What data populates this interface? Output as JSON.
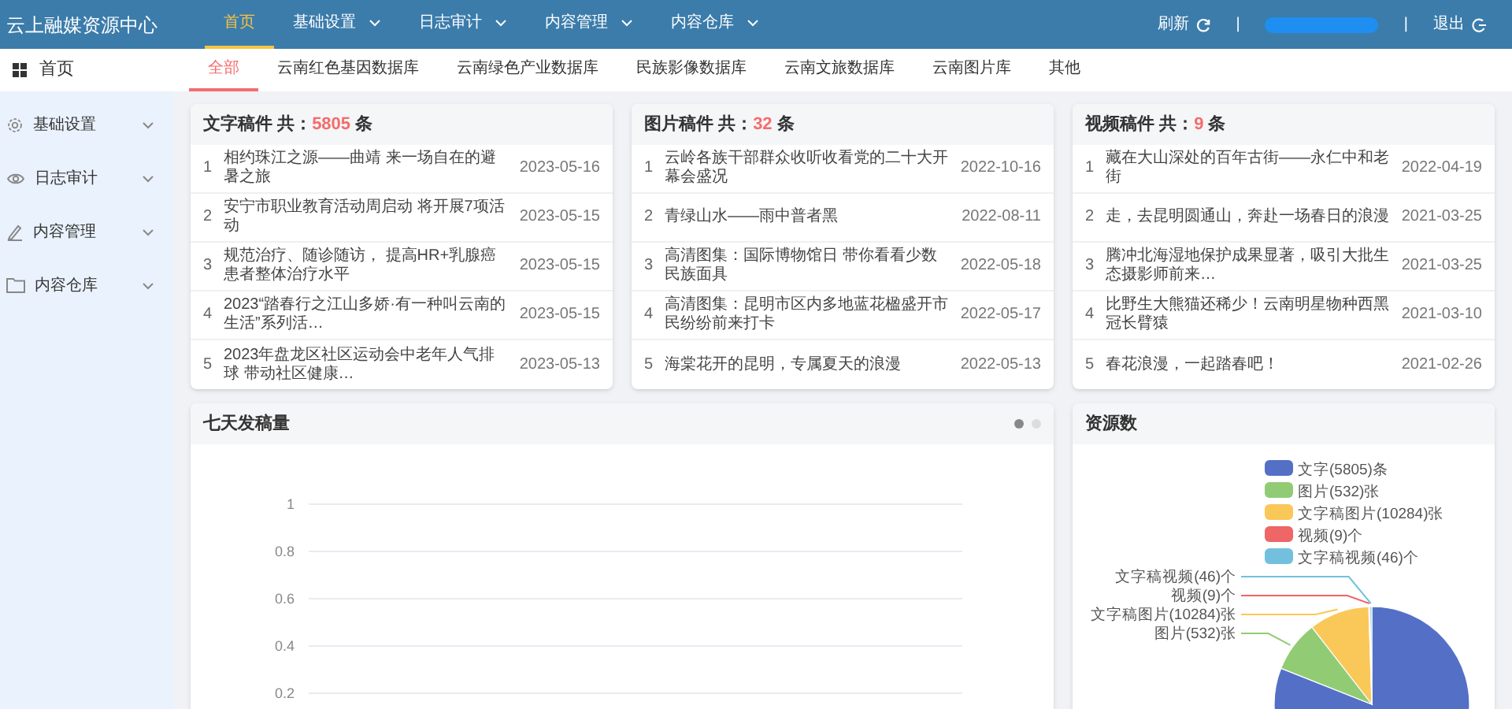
{
  "app_title": "云上融媒资源中心",
  "nav": [
    {
      "label": "首页",
      "selected": true,
      "has_menu": false
    },
    {
      "label": "基础设置",
      "selected": false,
      "has_menu": true
    },
    {
      "label": "日志审计",
      "selected": false,
      "has_menu": true
    },
    {
      "label": "内容管理",
      "selected": false,
      "has_menu": true
    },
    {
      "label": "内容仓库",
      "selected": false,
      "has_menu": true
    }
  ],
  "header_actions": {
    "refresh": "刷新",
    "separator": "|",
    "logout": "退出"
  },
  "sidebar": {
    "home": "首页",
    "items": [
      {
        "label": "基础设置"
      },
      {
        "label": "日志审计"
      },
      {
        "label": "内容管理"
      },
      {
        "label": "内容仓库"
      }
    ]
  },
  "tabs": [
    {
      "label": "全部",
      "selected": true
    },
    {
      "label": "云南红色基因数据库",
      "selected": false
    },
    {
      "label": "云南绿色产业数据库",
      "selected": false
    },
    {
      "label": "民族影像数据库",
      "selected": false
    },
    {
      "label": "云南文旅数据库",
      "selected": false
    },
    {
      "label": "云南图片库",
      "selected": false
    },
    {
      "label": "其他",
      "selected": false
    }
  ],
  "cards": [
    {
      "title": "文字稿件 共：",
      "count": "5805",
      "unit": " 条",
      "rows": [
        {
          "index": "1",
          "title": "相约珠江之源——曲靖 来一场自在的避暑之旅",
          "date": "2023-05-16"
        },
        {
          "index": "2",
          "title": "安宁市职业教育活动周启动 将开展7项活动",
          "date": "2023-05-15"
        },
        {
          "index": "3",
          "title": "规范治疗、随诊随访， 提高HR+乳腺癌患者整体治疗水平",
          "date": "2023-05-15"
        },
        {
          "index": "4",
          "title": "2023“踏春行之江山多娇·有一种叫云南的生活”系列活…",
          "date": "2023-05-15"
        },
        {
          "index": "5",
          "title": "2023年盘龙区社区运动会中老年人气排球 带动社区健康…",
          "date": "2023-05-13"
        }
      ]
    },
    {
      "title": "图片稿件 共：",
      "count": "32",
      "unit": " 条",
      "rows": [
        {
          "index": "1",
          "title": "云岭各族干部群众收听收看党的二十大开幕会盛况",
          "date": "2022-10-16"
        },
        {
          "index": "2",
          "title": "青绿山水——雨中普者黑",
          "date": "2022-08-11"
        },
        {
          "index": "3",
          "title": "高清图集：国际博物馆日 带你看看少数民族面具",
          "date": "2022-05-18"
        },
        {
          "index": "4",
          "title": "高清图集：昆明市区内多地蓝花楹盛开市民纷纷前来打卡",
          "date": "2022-05-17"
        },
        {
          "index": "5",
          "title": "海棠花开的昆明，专属夏天的浪漫",
          "date": "2022-05-13"
        }
      ]
    },
    {
      "title": "视频稿件 共：",
      "count": "9",
      "unit": " 条",
      "rows": [
        {
          "index": "1",
          "title": "藏在大山深处的百年古街——永仁中和老街",
          "date": "2022-04-19"
        },
        {
          "index": "2",
          "title": "走，去昆明圆通山，奔赴一场春日的浪漫",
          "date": "2021-03-25"
        },
        {
          "index": "3",
          "title": "腾冲北海湿地保护成果显著，吸引大批生态摄影师前来…",
          "date": "2021-03-25"
        },
        {
          "index": "4",
          "title": "比野生大熊猫还稀少！云南明星物种西黑冠长臂猿",
          "date": "2021-03-10"
        },
        {
          "index": "5",
          "title": "春花浪漫，一起踏春吧！",
          "date": "2021-02-26"
        }
      ]
    }
  ],
  "trend": {
    "title": "七天发稿量",
    "pager_dots": [
      {
        "selected": true
      },
      {
        "selected": false
      }
    ],
    "yticks": [
      "1",
      "0.8",
      "0.6",
      "0.4",
      "0.2"
    ]
  },
  "resources": {
    "title": "资源数",
    "items": [
      {
        "legend_label": "文字(5805)条",
        "color": "#5470c6"
      },
      {
        "legend_label": "图片(532)张",
        "color": "#91cc75"
      },
      {
        "legend_label": "文字稿图片(10284)张",
        "color": "#fac858"
      },
      {
        "legend_label": "视频(9)个",
        "color": "#ee6666"
      },
      {
        "legend_label": "文字稿视频(46)个",
        "color": "#73c0de"
      }
    ],
    "slice_labels": [
      {
        "label": "文字稿视频(46)个",
        "color": "#73c0de"
      },
      {
        "label": "视频(9)个",
        "color": "#ee6666"
      },
      {
        "label": "文字稿图片(10284)张",
        "color": "#fac858"
      },
      {
        "label": "图片(532)张",
        "color": "#91cc75"
      }
    ]
  }
}
